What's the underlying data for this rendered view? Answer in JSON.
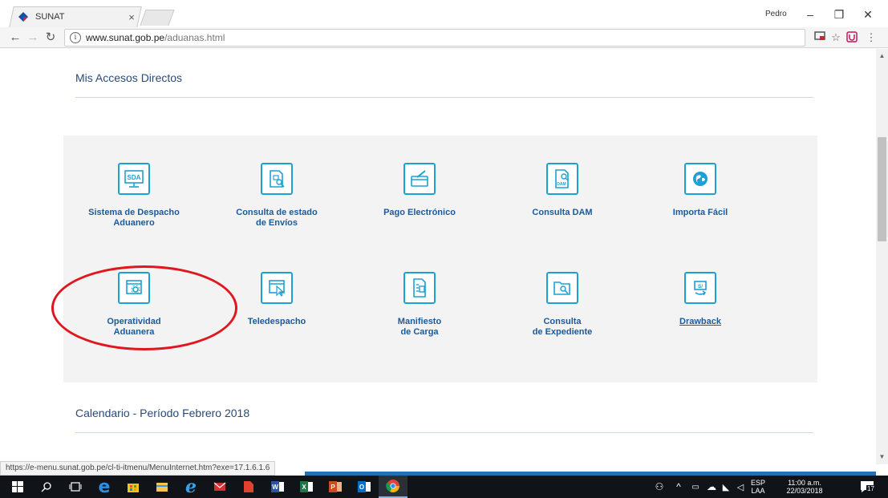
{
  "browser": {
    "tab_title": "SUNAT",
    "tab_close": "×",
    "user_name": "Pedro",
    "url_host": "www.sunat.gob.pe",
    "url_path": "/aduanas.html"
  },
  "page": {
    "section1_title": "Mis Accesos Directos",
    "section2_title": "Calendario - Período Febrero 2018",
    "shortcuts_row1": [
      {
        "label": "Sistema de Despacho\nAduanero",
        "icon": "sda-monitor-icon"
      },
      {
        "label": "Consulta de estado\nde Envíos",
        "icon": "document-search-icon"
      },
      {
        "label": "Pago Electrónico",
        "icon": "card-pen-icon"
      },
      {
        "label": "Consulta DAM",
        "icon": "dam-document-icon"
      },
      {
        "label": "Importa Fácil",
        "icon": "globe-icon"
      }
    ],
    "shortcuts_row2": [
      {
        "label": "Operatividad\nAduanera",
        "icon": "window-gear-icon"
      },
      {
        "label": "Teledespacho",
        "icon": "window-cursor-icon"
      },
      {
        "label": "Manifiesto\nde Carga",
        "icon": "manifest-icon"
      },
      {
        "label": "Consulta\nde Expediente",
        "icon": "folder-search-icon"
      },
      {
        "label": "Drawback",
        "icon": "soles-refund-icon"
      }
    ]
  },
  "status_url": "https://e-menu.sunat.gob.pe/cl-ti-itmenu/MenuInternet.htm?exe=17.1.6.1.6",
  "taskbar": {
    "lang_top": "ESP",
    "lang_bottom": "LAA",
    "time": "11:00 a.m.",
    "date": "22/03/2018",
    "notification_count": "17"
  },
  "colors": {
    "accent_icon": "#1ba1d5",
    "label_blue": "#1b5a9a",
    "highlight_red": "#e0171e"
  }
}
